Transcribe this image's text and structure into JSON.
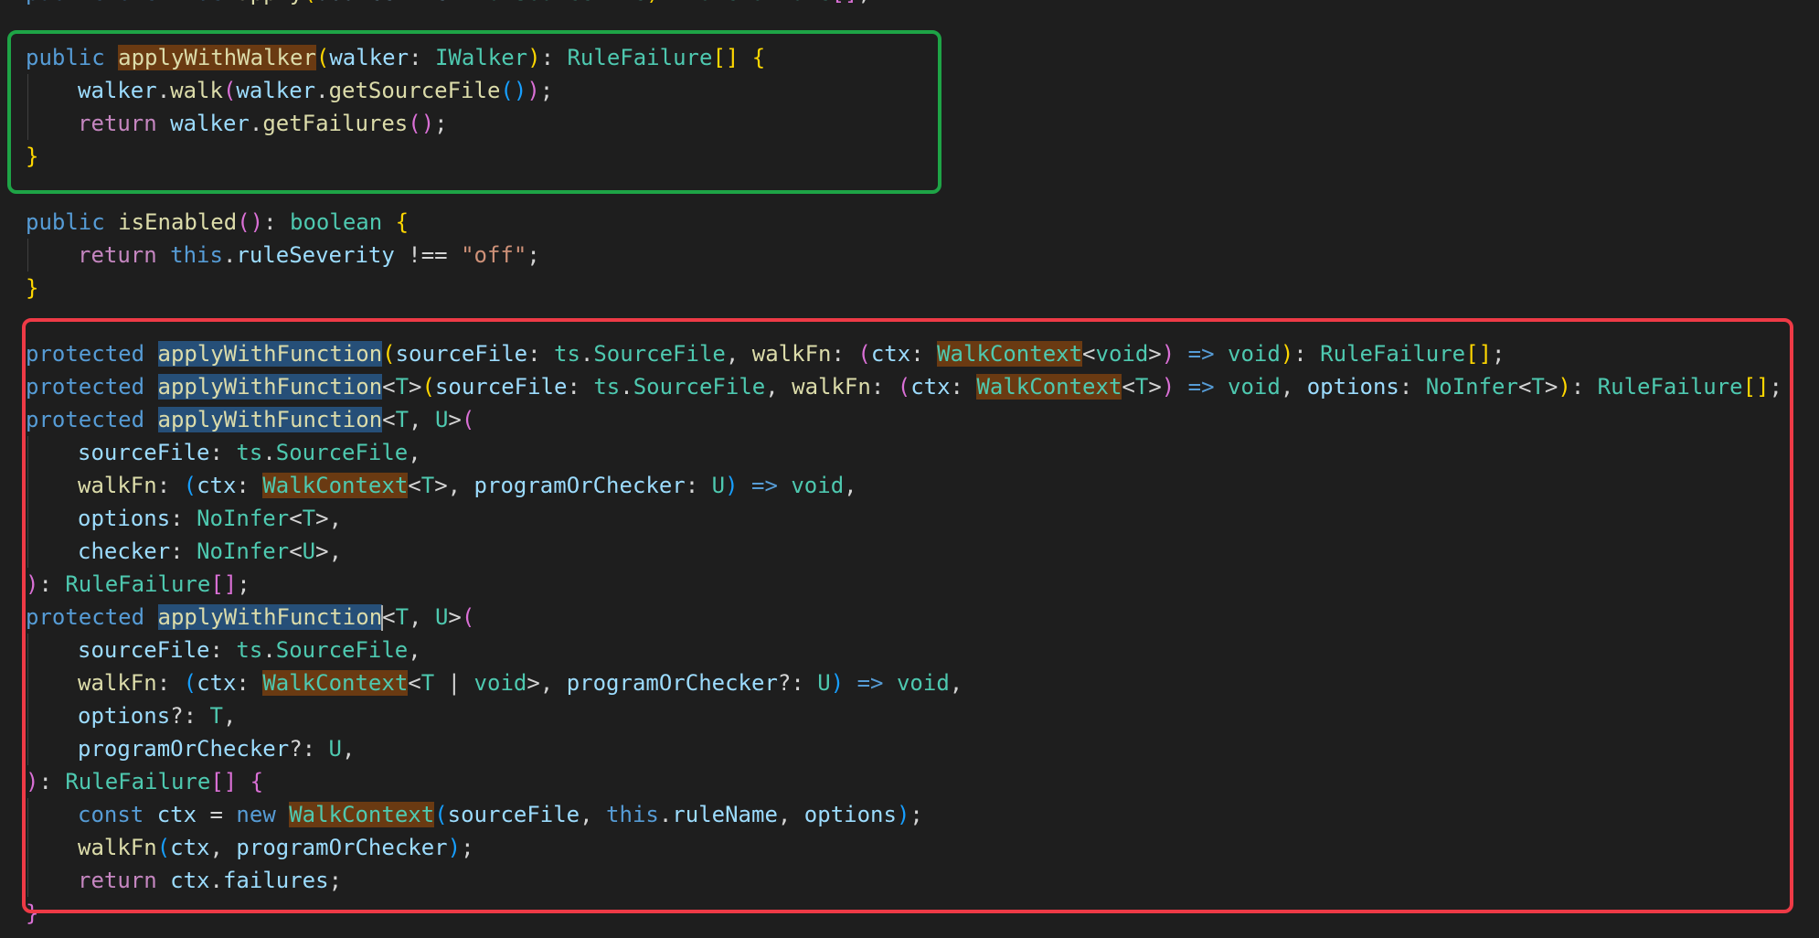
{
  "editor": {
    "language": "typescript",
    "cut_top_line": "public override apply(sourceFile: ts.SourceFile): RuleFailure[];",
    "block1": {
      "kw_public": "public",
      "method": "applyWithWalker",
      "param": "walker",
      "param_type": "IWalker",
      "return_type": "RuleFailure",
      "obj": "walker",
      "walk": "walk",
      "getSourceFile": "getSourceFile",
      "kw_return": "return",
      "getFailures": "getFailures"
    },
    "block2": {
      "kw_public": "public",
      "method": "isEnabled",
      "return_type": "boolean",
      "kw_return": "return",
      "kw_this": "this",
      "prop": "ruleSeverity",
      "op": "!==",
      "str": "\"off\""
    },
    "block3": {
      "kw_protected": "protected",
      "method": "applyWithFunction",
      "p_sourceFile": "sourceFile",
      "ns_ts": "ts",
      "t_SourceFile": "SourceFile",
      "p_walkFn": "walkFn",
      "p_ctx": "ctx",
      "t_WalkContext": "WalkContext",
      "kw_void": "void",
      "arrow": "=>",
      "t_RuleFailure": "RuleFailure",
      "tp_T": "T",
      "tp_U": "U",
      "p_options": "options",
      "t_NoInfer": "NoInfer",
      "p_programOrChecker": "programOrChecker",
      "p_checker": "checker",
      "kw_const": "const",
      "v_ctx": "ctx",
      "kw_new": "new",
      "kw_this": "this",
      "prop_ruleName": "ruleName",
      "fn_walkFn": "walkFn",
      "kw_return": "return",
      "prop_failures": "failures"
    },
    "annotations": {
      "green_box": "#1ea446",
      "red_box": "#ee3a46"
    },
    "colors": {
      "background": "#1e1e1e",
      "keyword": "#569cd6",
      "control": "#c586c0",
      "type": "#4ec9b0",
      "function": "#dcdcaa",
      "variable": "#9cdcfe",
      "string": "#ce9178",
      "word_highlight": "#6a3a12",
      "selection_highlight": "#264f78"
    }
  }
}
